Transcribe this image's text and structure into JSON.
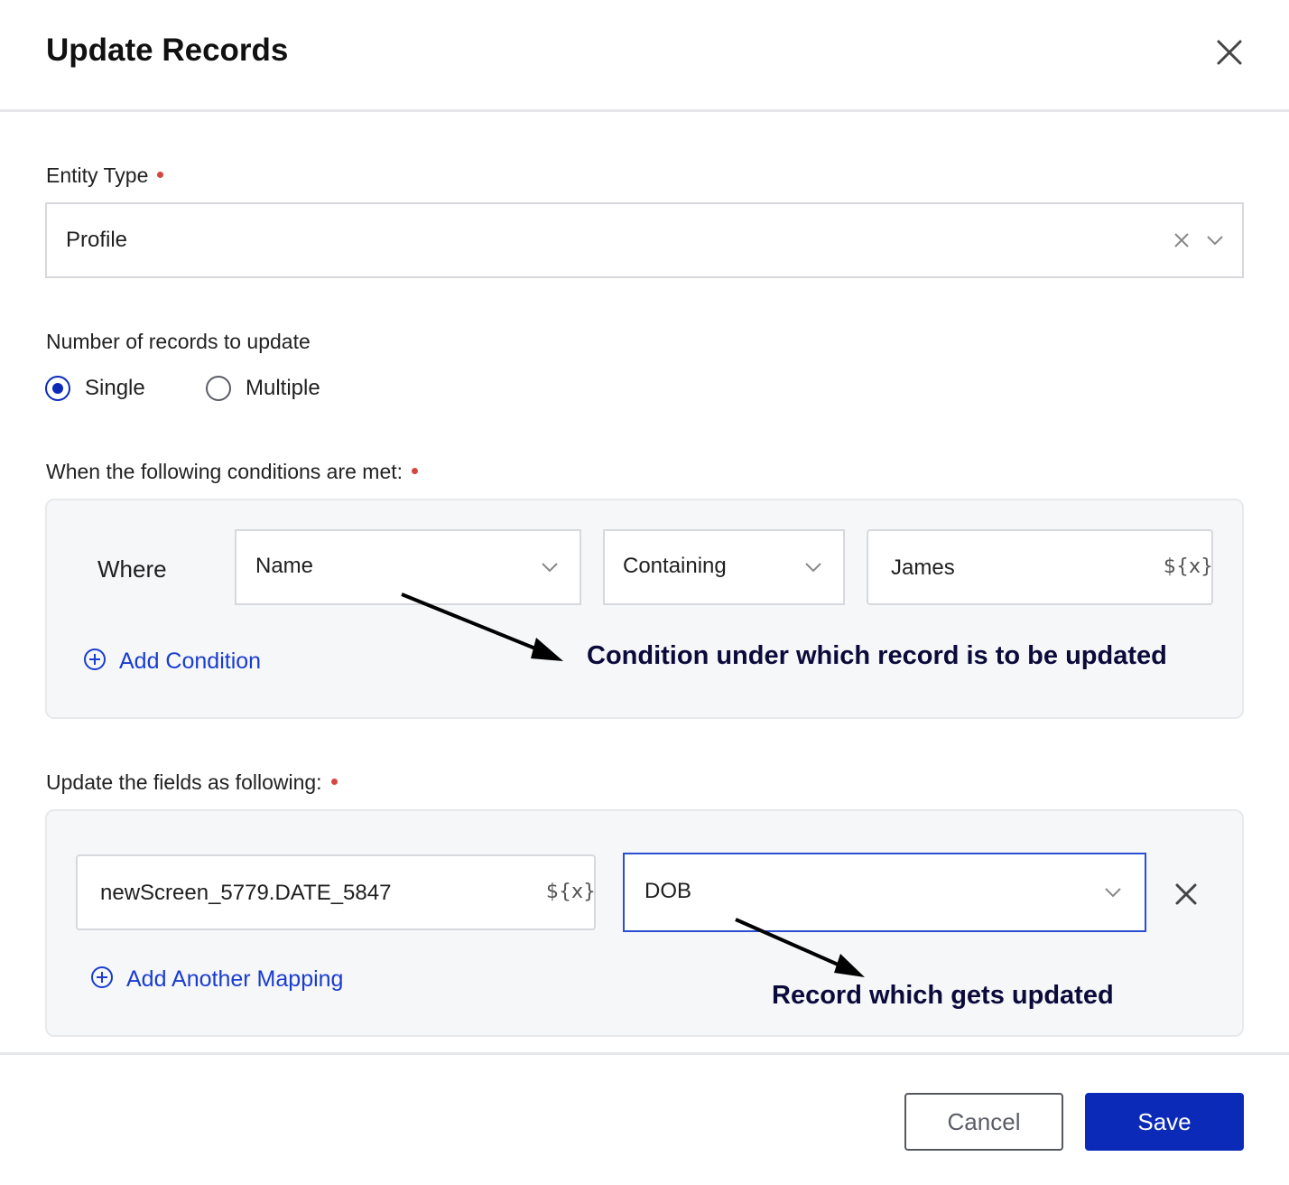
{
  "dialog": {
    "title": "Update Records"
  },
  "entity_type": {
    "label": "Entity Type",
    "value": "Profile"
  },
  "records_count": {
    "label": "Number of records to update",
    "options": [
      {
        "label": "Single",
        "selected": true
      },
      {
        "label": "Multiple",
        "selected": false
      }
    ]
  },
  "conditions": {
    "label": "When the following conditions are met:",
    "where_label": "Where",
    "field": "Name",
    "operator": "Containing",
    "value": "James",
    "variable_tag": "${x}",
    "add_label": "Add Condition",
    "annotation": "Condition under which record is to be updated"
  },
  "mapping": {
    "label": "Update the fields as following:",
    "source": "newScreen_5779.DATE_5847",
    "variable_tag": "${x}",
    "target": "DOB",
    "add_label": "Add Another Mapping",
    "annotation": "Record which gets updated"
  },
  "footer": {
    "cancel_label": "Cancel",
    "save_label": "Save"
  },
  "colors": {
    "primary": "#0b2ab8",
    "link": "#1a3ccf",
    "required": "#d6453f",
    "panel_bg": "#f6f7f9"
  }
}
